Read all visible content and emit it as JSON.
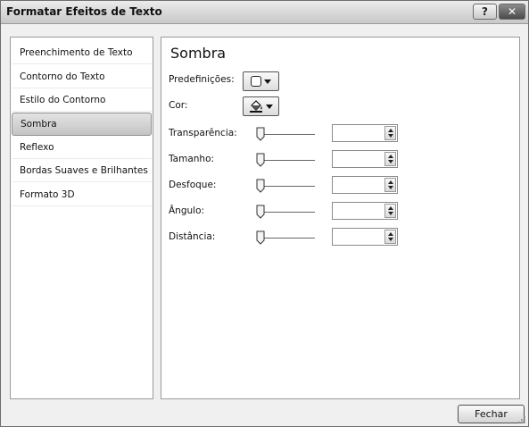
{
  "window": {
    "title": "Formatar Efeitos de Texto",
    "help_label": "?",
    "close_label": "✕"
  },
  "sidebar": {
    "items": [
      {
        "label": "Preenchimento de Texto",
        "selected": false
      },
      {
        "label": "Contorno do Texto",
        "selected": false
      },
      {
        "label": "Estilo do Contorno",
        "selected": false
      },
      {
        "label": "Sombra",
        "selected": true
      },
      {
        "label": "Reflexo",
        "selected": false
      },
      {
        "label": "Bordas Suaves e Brilhantes",
        "selected": false
      },
      {
        "label": "Formato 3D",
        "selected": false
      }
    ]
  },
  "shadow": {
    "title": "Sombra",
    "presets_label": "Predefinições:",
    "color_label": "Cor:",
    "sliders": [
      {
        "label": "Transparência:",
        "value": ""
      },
      {
        "label": "Tamanho:",
        "value": ""
      },
      {
        "label": "Desfoque:",
        "value": ""
      },
      {
        "label": "Ângulo:",
        "value": ""
      },
      {
        "label": "Distância:",
        "value": ""
      }
    ]
  },
  "footer": {
    "close_button": "Fechar"
  }
}
